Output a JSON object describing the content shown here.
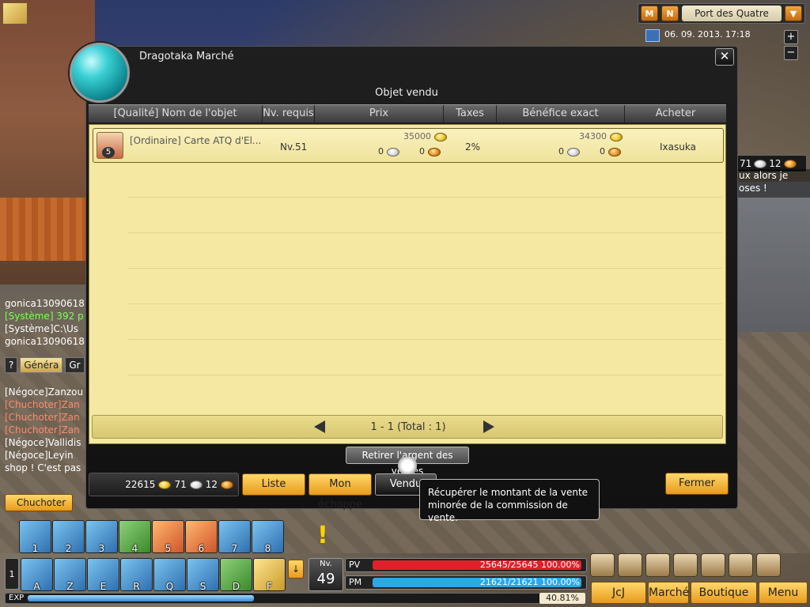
{
  "map": {
    "btn_m": "M",
    "btn_n": "N",
    "location": "Port des Quatre",
    "datetime": "06. 09. 2013. 17:18",
    "zoom_in": "+",
    "zoom_out": "−"
  },
  "window": {
    "title": "Dragotaka Marché",
    "close": "✕",
    "subtitle": "Objet vendu"
  },
  "table": {
    "headers": [
      "[Qualité] Nom de l'objet",
      "Nv. requis",
      "Prix",
      "Taxes",
      "Bénéfice exact",
      "Acheter"
    ],
    "rows": [
      {
        "stack": "5",
        "name": "[Ordinaire] Carte ATQ d'El...",
        "level": "Nv.51",
        "price_gold": "35000",
        "price_silver": "0",
        "price_bronze": "0",
        "tax": "2%",
        "profit_gold": "34300",
        "profit_silver": "0",
        "profit_bronze": "0",
        "buyer": "Ixasuka"
      }
    ]
  },
  "pager": {
    "count": "1 - 1 (Total : 1)"
  },
  "withdraw_label": "Retirer l'argent des ventes",
  "money": {
    "gold": "22615",
    "silver": "71",
    "bronze": "12"
  },
  "tabs": {
    "liste": "Liste",
    "echoppe": "Mon échoppe",
    "vendu": "Vendu"
  },
  "close_label": "Fermer",
  "tooltip": "Récupérer le montant de la vente minorée de la commission de vente.",
  "chat": {
    "lines_top": [
      {
        "text": "gonica13090618",
        "color": "#ffffff"
      },
      {
        "text": "[Système] 392 p",
        "color": "#7cff5a"
      },
      {
        "text": "[Système]C:\\Us",
        "color": "#ffffff"
      },
      {
        "text": "gonica13090618",
        "color": "#ffffff"
      }
    ],
    "tabs": [
      "?",
      "Généra",
      "Gr"
    ],
    "lines_bottom": [
      {
        "text": "[Négoce]Zanzou",
        "color": "#ffffff"
      },
      {
        "text": "[Chuchoter]Zan",
        "color": "#ff8a6a"
      },
      {
        "text": "[Chuchoter]Zan",
        "color": "#ff8a6a"
      },
      {
        "text": "[Chuchoter]Zan",
        "color": "#ff8a6a"
      },
      {
        "text": "[Négoce]Vallidis",
        "color": "#ffffff"
      },
      {
        "text": "[Négoce]Leyin",
        "color": "#ffffff"
      },
      {
        "text": "shop ! C'est pas",
        "color": "#ffffff"
      }
    ],
    "whisper": "Chuchoter"
  },
  "right": {
    "silver": "71",
    "bronze": "12",
    "chat_l1": "ux alors je",
    "chat_l2": "oses !"
  },
  "skills_top": [
    "1",
    "2",
    "3",
    "4",
    "5",
    "6",
    "7",
    "8"
  ],
  "skills_bottom": [
    "A",
    "Z",
    "E",
    "R",
    "Q",
    "S",
    "D",
    "F"
  ],
  "hotbar_page": "1",
  "status": {
    "lvl_label": "Nv.",
    "level": "49",
    "pv_label": "PV",
    "pv_text": "25645/25645 100.00%",
    "pv_fraction": 1.0,
    "pm_label": "PM",
    "pm_text": "21621/21621 100.00%",
    "pm_fraction": 1.0,
    "exp_label": "EXP",
    "exp_pct": "40.81%",
    "exp_fraction": 0.4081
  },
  "menu": {
    "jcj": "JcJ",
    "marche": "Marché",
    "boutique": "Boutique",
    "menu": "Menu"
  },
  "colors": {
    "pv": "#e0202a",
    "pm": "#2aa8e8",
    "accent": "#e89a1c"
  }
}
